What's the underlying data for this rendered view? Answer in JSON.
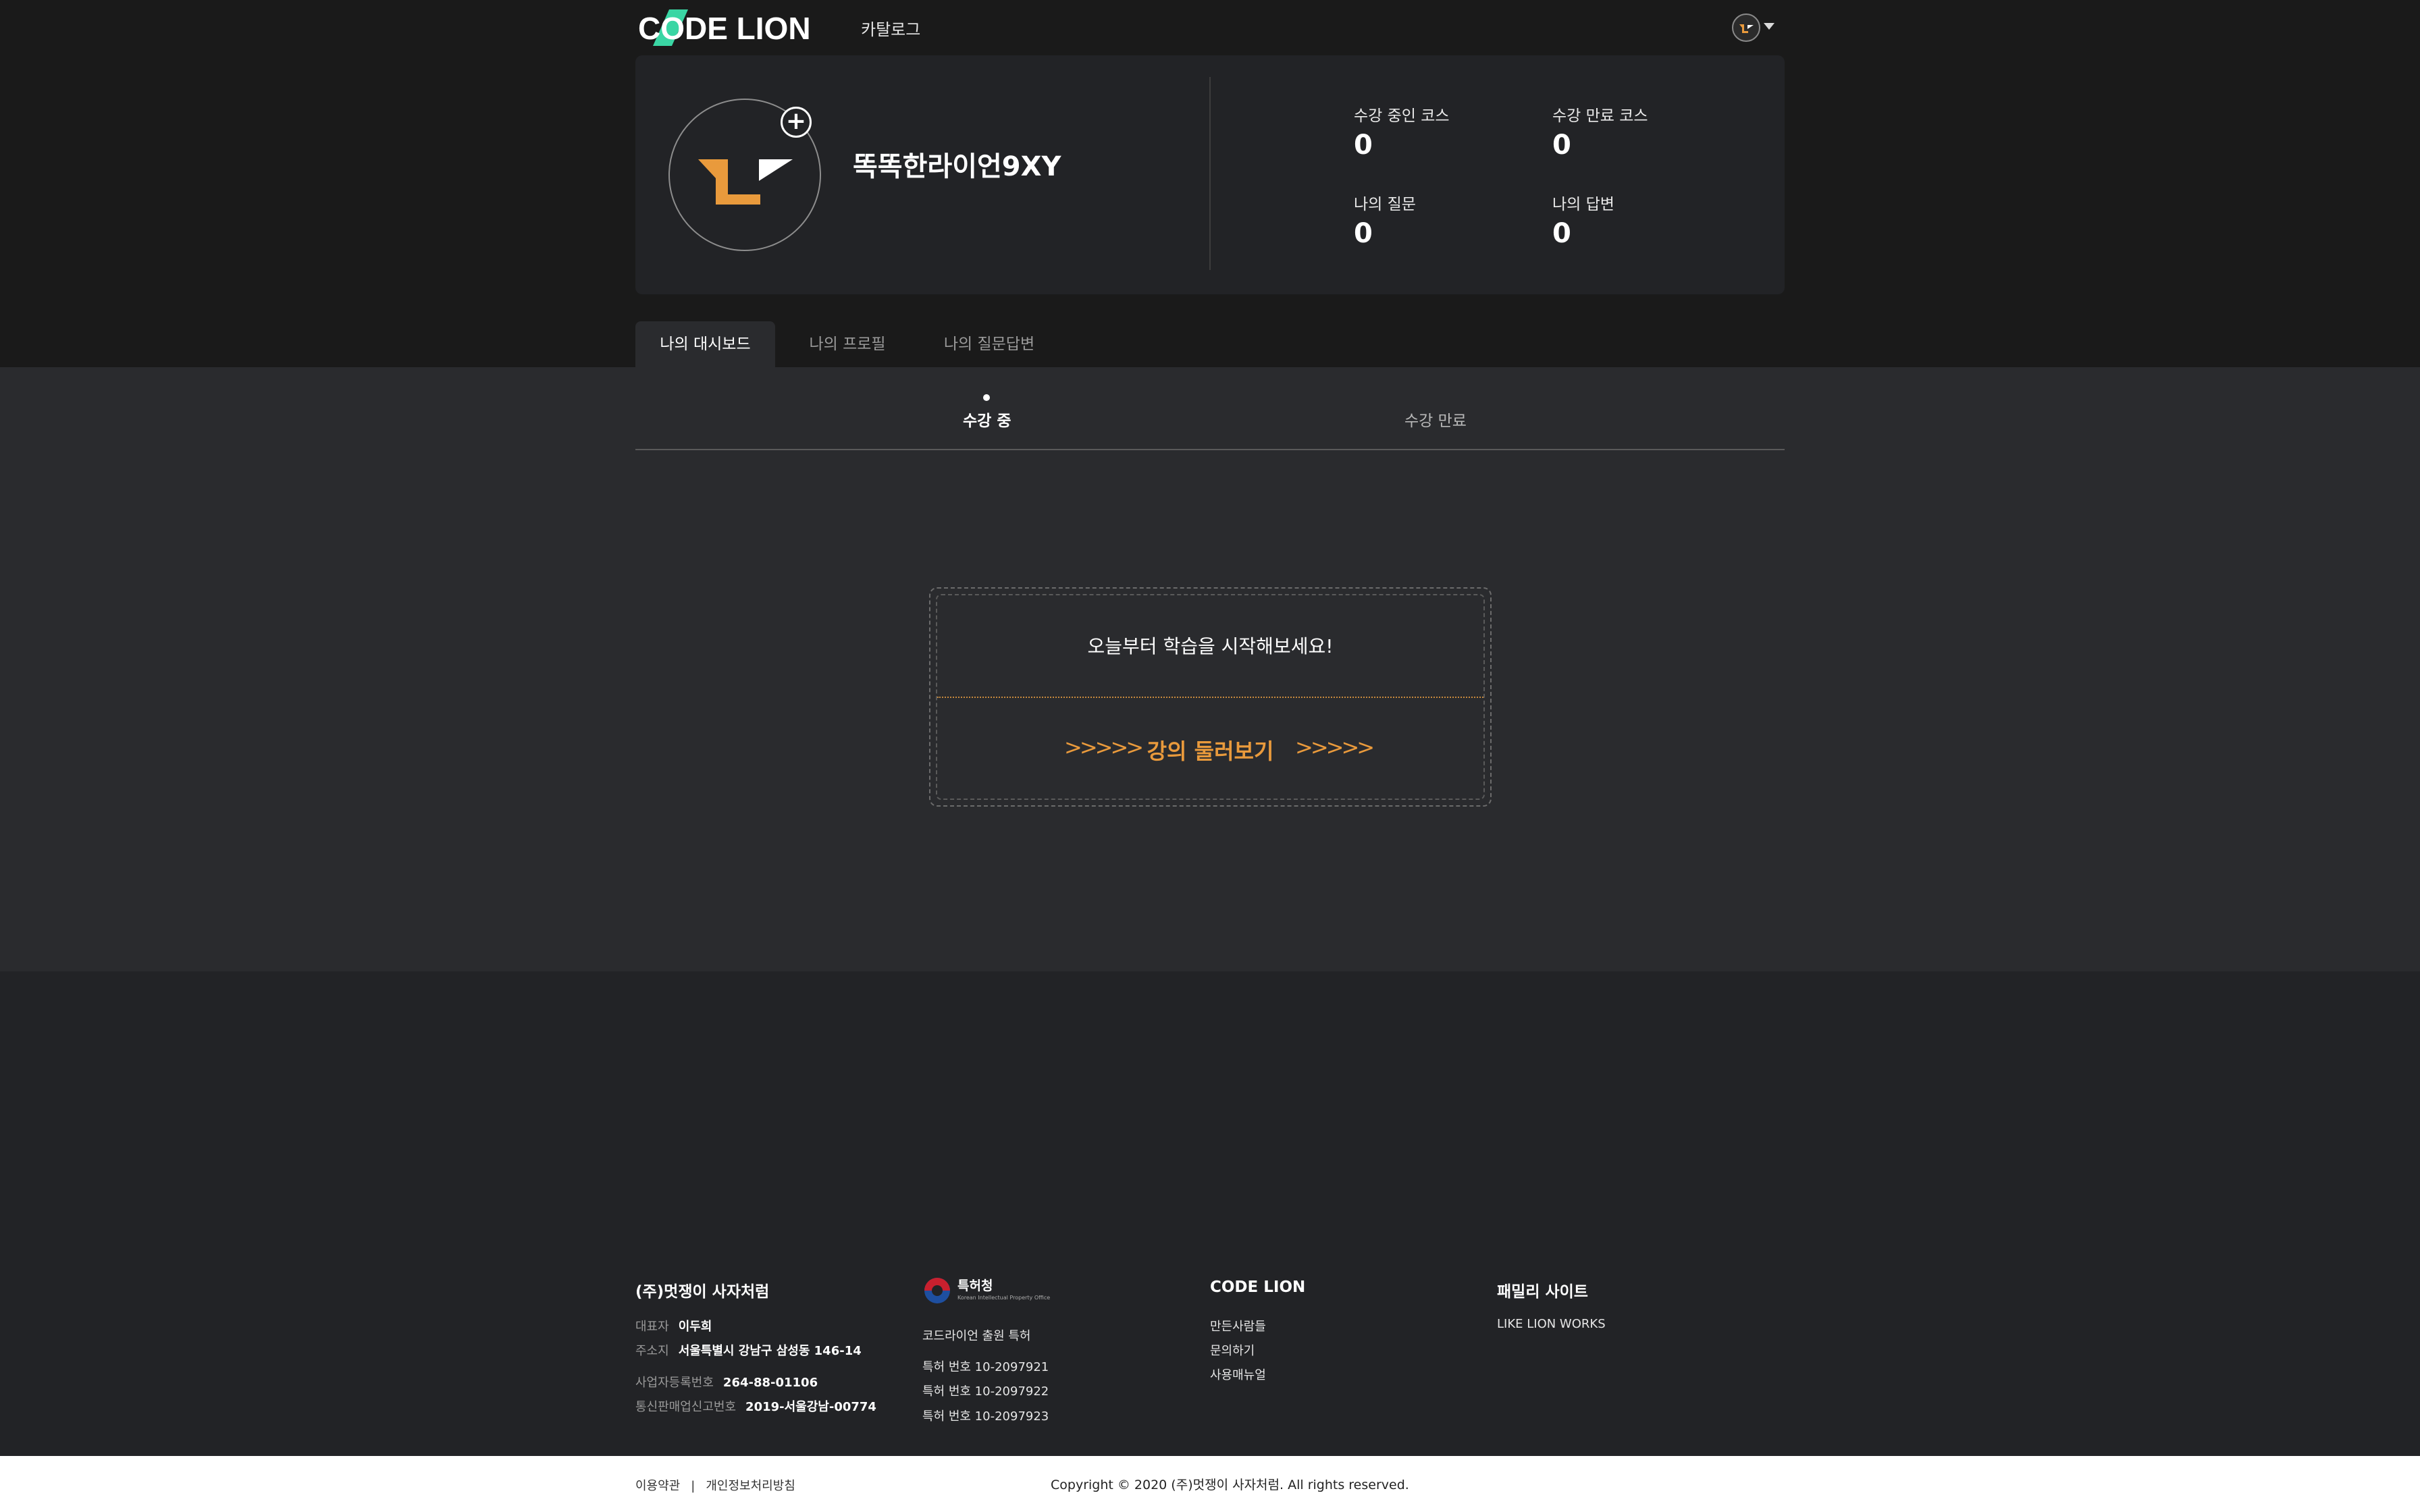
{
  "header": {
    "logo_text": "CODE LION",
    "nav_catalog": "카탈로그"
  },
  "profile": {
    "username": "똑똑한라이언9XY",
    "add_photo_symbol": "+",
    "stats": {
      "enrolled_label": "수강 중인 코스",
      "enrolled_value": "0",
      "completed_label": "수강 만료 코스",
      "completed_value": "0",
      "questions_label": "나의 질문",
      "questions_value": "0",
      "answers_label": "나의 답변",
      "answers_value": "0"
    }
  },
  "tabs": [
    "나의 대시보드",
    "나의 프로필",
    "나의 질문답변"
  ],
  "subtabs": {
    "active": "수강 중",
    "inactive": "수강 만료"
  },
  "cta": {
    "message": "오늘부터 학습을 시작해보세요!",
    "link": "강의 둘러보기",
    "chevrons": ">>>>>"
  },
  "footer": {
    "company": {
      "title": "(주)멋쟁이 사자처럼",
      "rows": [
        {
          "k": "대표자",
          "v": "이두희"
        },
        {
          "k": "주소지",
          "v": "서울특별시 강남구 삼성동 146-14"
        },
        {
          "k": "사업자등록번호",
          "v": "264-88-01106"
        },
        {
          "k": "통신판매업신고번호",
          "v": "2019-서울강남-00774"
        }
      ]
    },
    "patent": {
      "logo_text": "특허청",
      "logo_subtext": "Korean Intellectual Property Office",
      "heading": "코드라이언 출원 특허",
      "items": [
        "특허 번호 10-2097921",
        "특허 번호 10-2097922",
        "특허 번호 10-2097923"
      ]
    },
    "codelion": {
      "title": "CODE LION",
      "items": [
        "만든사람들",
        "문의하기",
        "사용매뉴얼"
      ]
    },
    "family": {
      "title": "패밀리 사이트",
      "items": [
        "LIKE LION WORKS"
      ]
    },
    "bottom": {
      "terms": "이용약관",
      "separator": "|",
      "privacy": "개인정보처리방침",
      "copyright": "Copyright © 2020 (주)멋쟁이 사자처럼. All rights reserved."
    }
  },
  "colors": {
    "accent_orange": "#e99a3c",
    "logo_green": "#3ad6a4",
    "background": "#1a1a1a",
    "panel": "#2a2b2e"
  }
}
